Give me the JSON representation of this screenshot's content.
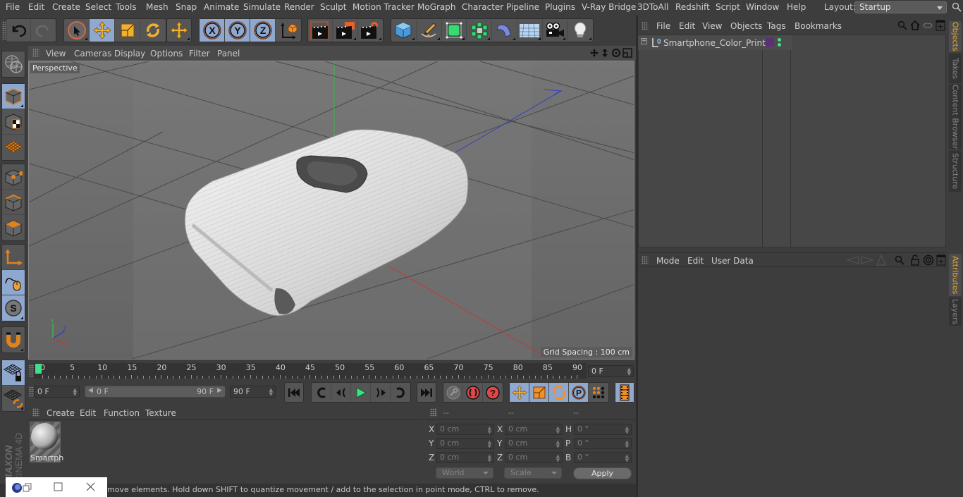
{
  "app": {
    "name": "CINEMA 4D",
    "vendor": "MAXON"
  },
  "menubar": {
    "items": [
      "File",
      "Edit",
      "Create",
      "Select",
      "Tools",
      "Mesh",
      "Snap",
      "Animate",
      "Simulate",
      "Render",
      "Sculpt",
      "Motion Tracker",
      "MoGraph",
      "Character",
      "Pipeline",
      "Plugins",
      "V-Ray Bridge",
      "3DToAll",
      "Redshift",
      "Script",
      "Window",
      "Help"
    ],
    "layout_label": "Layout:",
    "layout_value": "Startup"
  },
  "toolbar": {
    "groups": [
      [
        "undo-icon",
        "redo-icon"
      ],
      [
        "live-selection-icon",
        "move-icon",
        "scale-icon",
        "rotate-icon"
      ],
      [
        "last-tool-move-icon"
      ],
      [
        "x-axis-lock-icon",
        "y-axis-lock-icon",
        "z-axis-lock-icon",
        "coordinate-system-icon"
      ],
      [
        "render-view-icon",
        "render-picture-viewer-icon",
        "render-settings-icon"
      ],
      [
        "cube-primitive-icon",
        "pen-spline-icon",
        "subdivision-surface-icon",
        "cloner-icon",
        "deformer-bend-icon",
        "floor-environment-icon",
        "camera-icon",
        "light-icon"
      ]
    ],
    "active": [
      "move-icon",
      "x-axis-lock-icon",
      "y-axis-lock-icon",
      "z-axis-lock-icon"
    ]
  },
  "left_toolbar": {
    "items": [
      "make-editable-icon",
      "model-mode-icon",
      "texture-mode-icon",
      "workplane-mode-icon",
      "points-mode-icon",
      "edges-mode-icon",
      "polygons-mode-icon",
      "axis-mode-icon",
      "tweak-mode-icon",
      "solo-mode-icon",
      "snap-magnet-icon",
      "workplane-lock-icon",
      "workplane-align-icon"
    ]
  },
  "viewport": {
    "menu": [
      "View",
      "Cameras",
      "Display",
      "Options",
      "Filter",
      "Panel"
    ],
    "camera_label": "Perspective",
    "grid_spacing": "Grid Spacing : 100 cm",
    "axes": {
      "x": "X",
      "y": "Y",
      "z": "Z"
    },
    "colors": {
      "x_axis": "#c23a3a",
      "y_axis": "#3fb34f",
      "z_axis": "#3040c0"
    }
  },
  "timeline": {
    "ticks": [
      "0",
      "5",
      "10",
      "15",
      "20",
      "25",
      "30",
      "35",
      "40",
      "45",
      "50",
      "55",
      "60",
      "65",
      "70",
      "75",
      "80",
      "85",
      "90"
    ],
    "current_frame": 0,
    "current_frame_field": "0 F",
    "start_field": "0 F",
    "range_start": "0 F",
    "range_end": "90 F",
    "end_field": "90 F",
    "playhead_color": "#3fe08a"
  },
  "materials": {
    "menu": [
      "Create",
      "Edit",
      "Function",
      "Texture"
    ],
    "items": [
      {
        "name": "Smartph"
      }
    ]
  },
  "coordinates": {
    "headers": [
      "--",
      "--",
      "--"
    ],
    "position": {
      "x": "0 cm",
      "y": "0 cm",
      "z": "0 cm"
    },
    "size": {
      "x": "0 cm",
      "y": "0 cm",
      "z": "0 cm"
    },
    "rotation": {
      "h": "0 °",
      "p": "0 °",
      "b": "0 °"
    },
    "labels": {
      "x": "X",
      "y": "Y",
      "z": "Z",
      "h": "H",
      "p": "P",
      "b": "B"
    },
    "space": "World",
    "mode": "Scale",
    "apply_label": "Apply"
  },
  "status_bar": {
    "text": "move elements. Hold down SHIFT to quantize movement / add to the selection in point mode, CTRL to remove."
  },
  "objects_panel": {
    "menu": [
      "File",
      "Edit",
      "View",
      "Objects",
      "Tags",
      "Bookmarks"
    ],
    "objects": [
      {
        "name": "Smartphone_Color_Printer",
        "layer_color": "#5b2f7a",
        "visibility_dots": "#3fe08a"
      }
    ]
  },
  "attributes_panel": {
    "menu": [
      "Mode",
      "Edit",
      "User Data"
    ]
  },
  "right_tabs": {
    "top": [
      "Objects",
      "Takes",
      "Content Browser",
      "Structure"
    ],
    "bottom": [
      "Attributes",
      "Layers"
    ],
    "active_color": "#e8a838"
  },
  "branding": {
    "maxon": "MAXON",
    "product": "CINEMA 4D"
  }
}
